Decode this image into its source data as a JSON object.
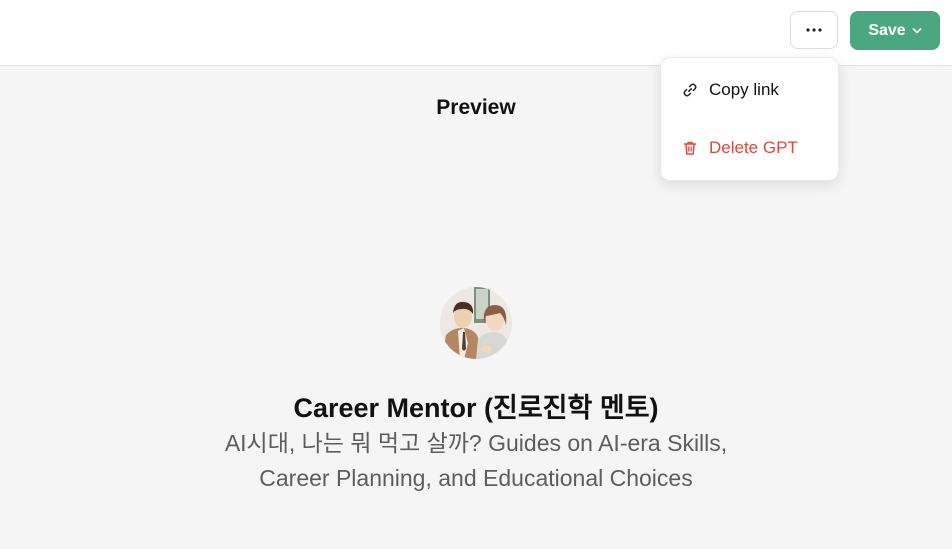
{
  "header": {
    "more_label": "···",
    "save_label": "Save"
  },
  "menu": {
    "items": [
      {
        "label": "Copy link",
        "icon": "link-icon"
      },
      {
        "label": "Delete GPT",
        "icon": "trash-icon",
        "color": "#e0473d"
      }
    ]
  },
  "preview": {
    "title": "Preview",
    "gpt_name": "Career Mentor (진로진학 멘토)",
    "description_line1": "AI시대, 나는 뭐 먹고 살까? Guides on AI-era Skills,",
    "description_line2": "Career Planning, and Educational Choices"
  },
  "colors": {
    "accent": "#4ba77f",
    "danger": "#e0473d"
  }
}
